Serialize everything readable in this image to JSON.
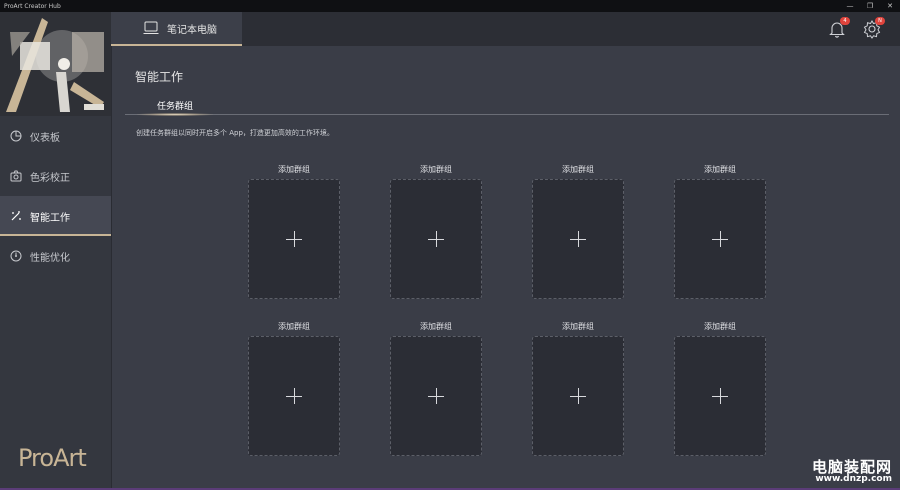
{
  "window": {
    "title": "ProArt Creator Hub",
    "minimize": "—",
    "restore": "❐",
    "close": "✕"
  },
  "sidebar": {
    "items": [
      {
        "label": "仪表板",
        "icon": "pie-chart-icon"
      },
      {
        "label": "色彩校正",
        "icon": "color-calibration-icon"
      },
      {
        "label": "智能工作",
        "icon": "magic-wand-icon",
        "active": true
      },
      {
        "label": "性能优化",
        "icon": "gauge-icon"
      }
    ],
    "brand": "ProArt"
  },
  "topbar": {
    "device_label": "笔记本电脑",
    "notifications_count": "4",
    "settings_badge": "N"
  },
  "main": {
    "title": "智能工作",
    "tab": "任务群组",
    "description": "创建任务群组以同时开启多个 App，打造更加高效的工作环境。",
    "groups": [
      {
        "label": "添加群组"
      },
      {
        "label": "添加群组"
      },
      {
        "label": "添加群组"
      },
      {
        "label": "添加群组"
      },
      {
        "label": "添加群组"
      },
      {
        "label": "添加群组"
      },
      {
        "label": "添加群组"
      },
      {
        "label": "添加群组"
      }
    ]
  },
  "watermark": {
    "text": "电脑装配网",
    "url": "www.dnzp.com"
  },
  "colors": {
    "accent": "#c8b596",
    "badge": "#e0443d",
    "background": "#3a3d47"
  }
}
